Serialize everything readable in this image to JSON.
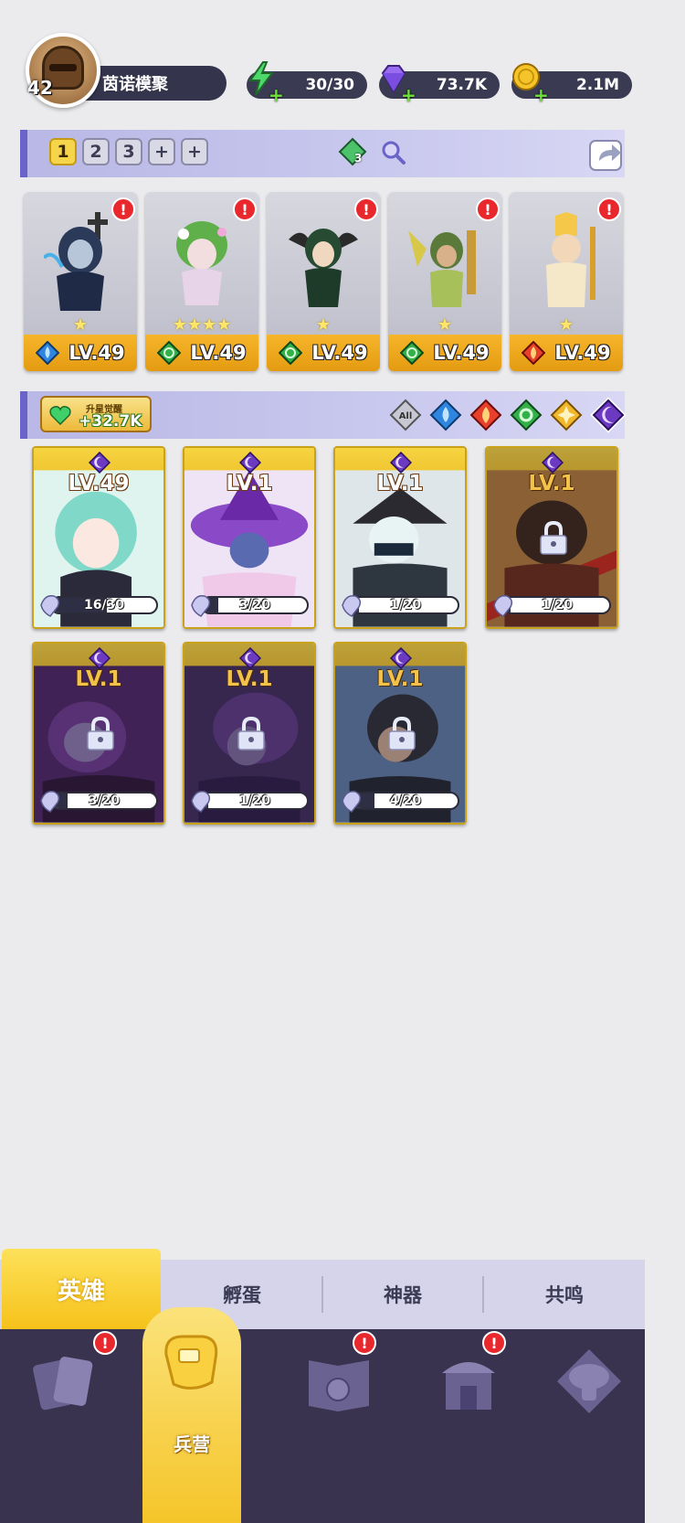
{
  "player": {
    "level": "42",
    "name": "茵诺模聚"
  },
  "resources": {
    "energy": "30/30",
    "gems": "73.7K",
    "coins": "2.1M"
  },
  "team_slots": [
    "1",
    "2",
    "3",
    "+",
    "+"
  ],
  "gem_chip_count": "3",
  "team_heroes": [
    {
      "element": "water",
      "level": "LV.49",
      "stars": "★",
      "alert": "!"
    },
    {
      "element": "nature",
      "level": "LV.49",
      "stars": "★★★★",
      "alert": "!"
    },
    {
      "element": "nature",
      "level": "LV.49",
      "stars": "★",
      "alert": "!"
    },
    {
      "element": "nature",
      "level": "LV.49",
      "stars": "★",
      "alert": "!"
    },
    {
      "element": "fire",
      "level": "LV.49",
      "stars": "★",
      "alert": "!"
    }
  ],
  "awaken": {
    "label": "升星觉醒",
    "value": "+32.7K"
  },
  "filters": [
    "All",
    "water",
    "fire",
    "nature",
    "light",
    "dark"
  ],
  "active_filter": "dark",
  "collection": [
    {
      "level": "LV.49",
      "shards": "16/30",
      "progress": 0.53,
      "locked": false,
      "theme": "#7fd8c8"
    },
    {
      "level": "LV.1",
      "shards": "3/20",
      "progress": 0.15,
      "locked": false,
      "theme": "#b07ad6"
    },
    {
      "level": "LV.1",
      "shards": "1/20",
      "progress": 0.05,
      "locked": false,
      "theme": "#5e6a74"
    },
    {
      "level": "LV.1",
      "shards": "1/20",
      "progress": 0.05,
      "locked": true,
      "theme": "#8a3a1c"
    },
    {
      "level": "LV.1",
      "shards": "3/20",
      "progress": 0.15,
      "locked": true,
      "theme": "#5a2a78"
    },
    {
      "level": "LV.1",
      "shards": "1/20",
      "progress": 0.05,
      "locked": true,
      "theme": "#4e3470"
    },
    {
      "level": "LV.1",
      "shards": "4/20",
      "progress": 0.2,
      "locked": true,
      "theme": "#4a6c96"
    }
  ],
  "subtabs": [
    "英雄",
    "孵蛋",
    "神器",
    "共鸣"
  ],
  "nav": {
    "active_label": "兵营",
    "alert": "!"
  },
  "colors": {
    "accent_gold": "#f6c21a",
    "panel_purple": "#6b64c8",
    "nav_bg": "#3a3350",
    "alert_red": "#e8282c"
  }
}
